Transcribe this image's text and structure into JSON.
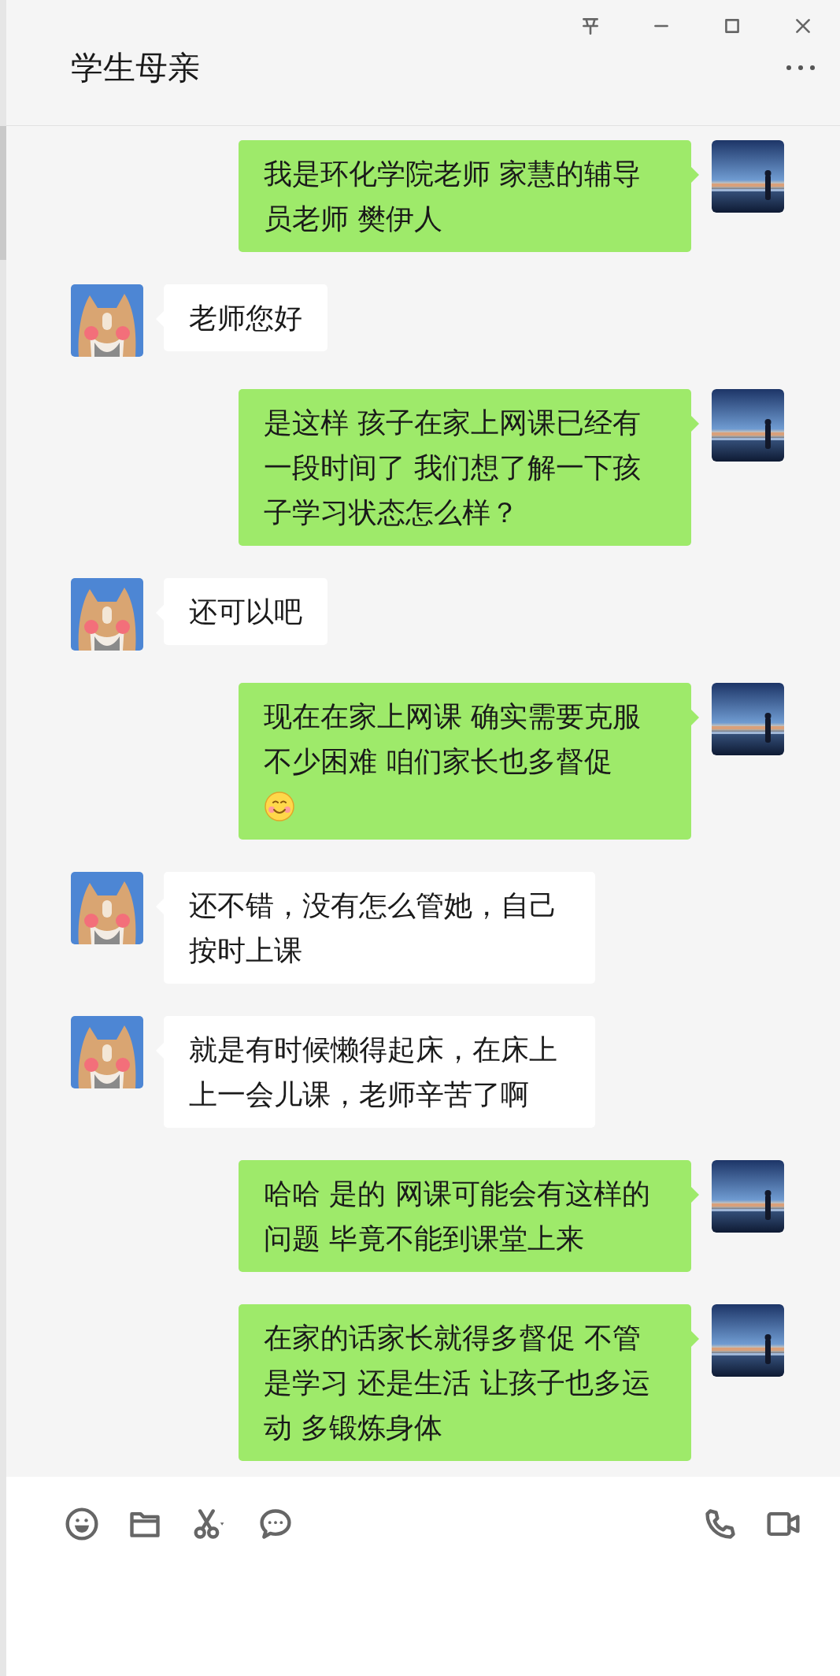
{
  "window": {
    "controls": [
      {
        "kind": "pin"
      },
      {
        "kind": "minimize"
      },
      {
        "kind": "maximize"
      },
      {
        "kind": "close"
      }
    ]
  },
  "header": {
    "title": "学生母亲"
  },
  "messages": [
    {
      "kind": "self",
      "text": "我是环化学院老师 家慧的辅导员老师 樊伊人"
    },
    {
      "kind": "other",
      "text": "老师您好"
    },
    {
      "kind": "self",
      "text": "是这样 孩子在家上网课已经有一段时间了 我们想了解一下孩子学习状态怎么样？"
    },
    {
      "kind": "other",
      "text": "还可以吧"
    },
    {
      "kind": "self",
      "text": "现在在家上网课 确实需要克服不少困难 咱们家长也多督促",
      "has_emoji": true
    },
    {
      "kind": "other",
      "text": "还不错，没有怎么管她，自己按时上课"
    },
    {
      "kind": "other",
      "text": "就是有时候懒得起床，在床上上一会儿课，老师辛苦了啊"
    },
    {
      "kind": "self",
      "text": "哈哈 是的 网课可能会有这样的问题 毕竟不能到课堂上来"
    },
    {
      "kind": "self",
      "text": "在家的话家长就得多督促 不管是学习 还是生活 让孩子也多运动 多锻炼身体"
    }
  ],
  "toolbar": {
    "left": [
      {
        "kind": "emoji"
      },
      {
        "kind": "file"
      },
      {
        "kind": "screenshot"
      },
      {
        "kind": "chat-history"
      }
    ],
    "right": [
      {
        "kind": "voice-call"
      },
      {
        "kind": "video-call"
      }
    ]
  }
}
